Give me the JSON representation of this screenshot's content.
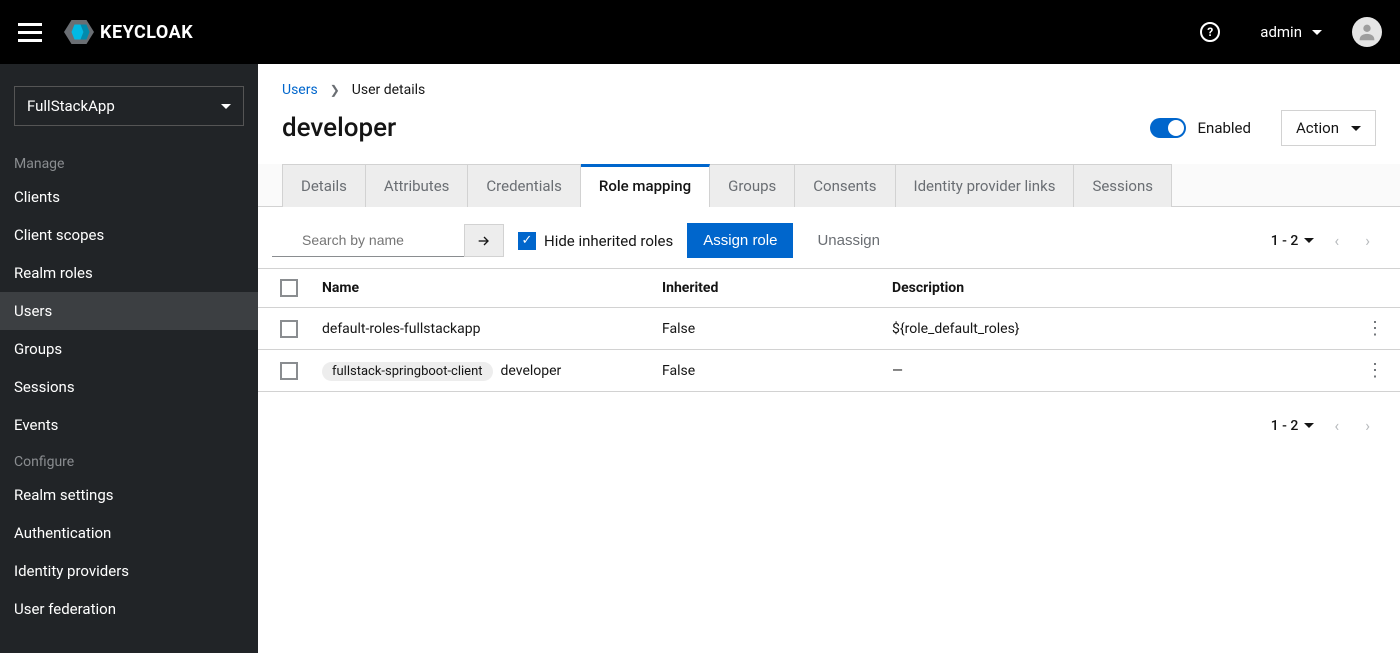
{
  "header": {
    "brand": "KEYCLOAK",
    "user": "admin"
  },
  "sidebar": {
    "realm": "FullStackApp",
    "sections": [
      {
        "label": "Manage",
        "items": [
          "Clients",
          "Client scopes",
          "Realm roles",
          "Users",
          "Groups",
          "Sessions",
          "Events"
        ],
        "activeIndex": 3
      },
      {
        "label": "Configure",
        "items": [
          "Realm settings",
          "Authentication",
          "Identity providers",
          "User federation"
        ],
        "activeIndex": -1
      }
    ]
  },
  "breadcrumb": {
    "root": "Users",
    "current": "User details"
  },
  "page": {
    "title": "developer",
    "enabledLabel": "Enabled",
    "actionLabel": "Action"
  },
  "tabs": {
    "items": [
      "Details",
      "Attributes",
      "Credentials",
      "Role mapping",
      "Groups",
      "Consents",
      "Identity provider links",
      "Sessions"
    ],
    "activeIndex": 3
  },
  "toolbar": {
    "searchPlaceholder": "Search by name",
    "hideInherited": "Hide inherited roles",
    "assign": "Assign role",
    "unassign": "Unassign",
    "range": "1 - 2"
  },
  "table": {
    "headers": {
      "name": "Name",
      "inherited": "Inherited",
      "description": "Description"
    },
    "rows": [
      {
        "client": "",
        "name": "default-roles-fullstackapp",
        "inherited": "False",
        "description": "${role_default_roles}"
      },
      {
        "client": "fullstack-springboot-client",
        "name": "developer",
        "inherited": "False",
        "description": "—"
      }
    ]
  }
}
